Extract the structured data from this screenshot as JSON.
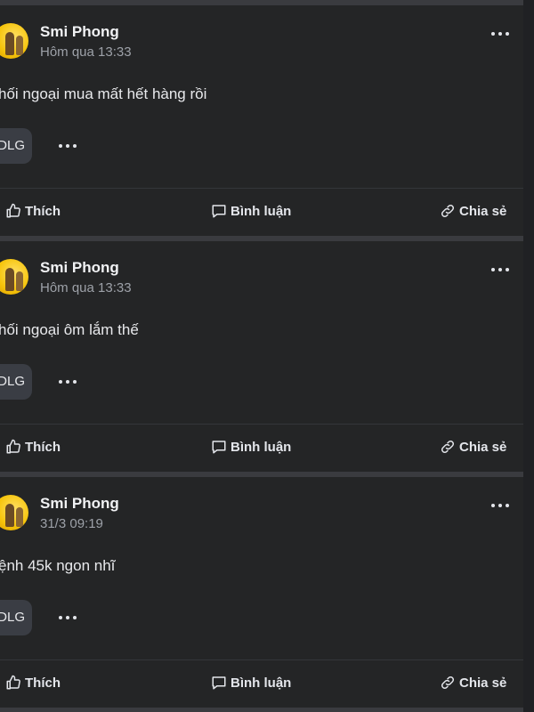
{
  "posts": [
    {
      "author": "Smi Phong",
      "time": "Hôm qua 13:33",
      "content": "hối ngoại mua mất hết hàng rồi",
      "tag": "DLG"
    },
    {
      "author": "Smi Phong",
      "time": "Hôm qua 13:33",
      "content": "hối ngoại ôm lắm thế",
      "tag": "DLG"
    },
    {
      "author": "Smi Phong",
      "time": "31/3 09:19",
      "content": "ệnh 45k ngon nhĩ",
      "tag": "DLG"
    }
  ],
  "actions": {
    "like": "Thích",
    "comment": "Bình luận",
    "share": "Chia sẻ"
  },
  "icons": {
    "like": "thumbs-up-icon",
    "comment": "comment-icon",
    "share": "link-icon",
    "more": "more-horizontal-icon"
  },
  "colors": {
    "page_bg": "#3a3b3f",
    "card_bg": "#242526",
    "text_primary": "#e8e9ec",
    "text_secondary": "#9da1a8",
    "tag_bg": "#3a3d44"
  }
}
